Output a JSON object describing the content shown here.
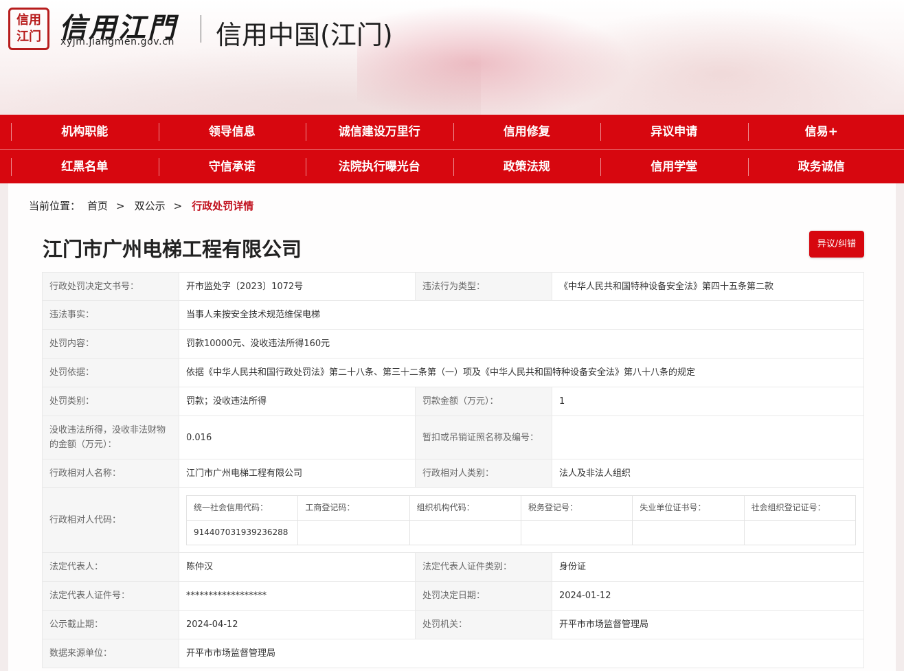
{
  "header": {
    "logo_chars": [
      "信",
      "用",
      "江",
      "门"
    ],
    "logo_text": "信用江門",
    "logo_url": "xyjm.jiangmen.gov.cn",
    "site_title": "信用中国(江门)"
  },
  "nav": {
    "row1": [
      "机构职能",
      "领导信息",
      "诚信建设万里行",
      "信用修复",
      "异议申请",
      "信易+"
    ],
    "row2": [
      "红黑名单",
      "守信承诺",
      "法院执行曝光台",
      "政策法规",
      "信用学堂",
      "政务诚信"
    ]
  },
  "breadcrumb": {
    "prefix": "当前位置：",
    "items": [
      "首页",
      "双公示",
      "行政处罚详情"
    ],
    "sep": ">"
  },
  "company": {
    "name": "江门市广州电梯工程有限公司",
    "dispute_label": "异议/纠错"
  },
  "details": {
    "doc_no_label": "行政处罚决定文书号：",
    "doc_no": "开市监处字〔2023〕1072号",
    "violation_type_label": "违法行为类型：",
    "violation_type": "《中华人民共和国特种设备安全法》第四十五条第二款",
    "facts_label": "违法事实：",
    "facts": "当事人未按安全技术规范维保电梯",
    "content_label": "处罚内容：",
    "content": "罚款10000元、没收违法所得160元",
    "basis_label": "处罚依据：",
    "basis": "依据《中华人民共和国行政处罚法》第二十八条、第三十二条第（一）项及《中华人民共和国特种设备安全法》第八十八条的规定",
    "category_label": "处罚类别：",
    "category": "罚款；没收违法所得",
    "fine_label": "罚款金额（万元）：",
    "fine": "1",
    "confiscated_label": "没收违法所得，没收非法财物的金额（万元）：",
    "confiscated": "0.016",
    "license_label": "暂扣或吊销证照名称及编号：",
    "license": "",
    "party_name_label": "行政相对人名称：",
    "party_name": "江门市广州电梯工程有限公司",
    "party_type_label": "行政相对人类别：",
    "party_type": "法人及非法人组织",
    "party_code_label": "行政相对人代码：",
    "codes": {
      "headers": [
        "统一社会信用代码：",
        "工商登记码：",
        "组织机构代码：",
        "税务登记号：",
        "失业单位证书号：",
        "社会组织登记证号："
      ],
      "values": [
        "914407031939236288",
        "",
        "",
        "",
        "",
        ""
      ]
    },
    "legal_rep_label": "法定代表人：",
    "legal_rep": "陈仲汉",
    "legal_id_type_label": "法定代表人证件类别：",
    "legal_id_type": "身份证",
    "legal_id_no_label": "法定代表人证件号：",
    "legal_id_no": "******************",
    "decision_date_label": "处罚决定日期：",
    "decision_date": "2024-01-12",
    "publish_end_label": "公示截止期：",
    "publish_end": "2024-04-12",
    "authority_label": "处罚机关：",
    "authority": "开平市市场监督管理局",
    "source_label": "数据来源单位：",
    "source": "开平市市场监督管理局"
  }
}
